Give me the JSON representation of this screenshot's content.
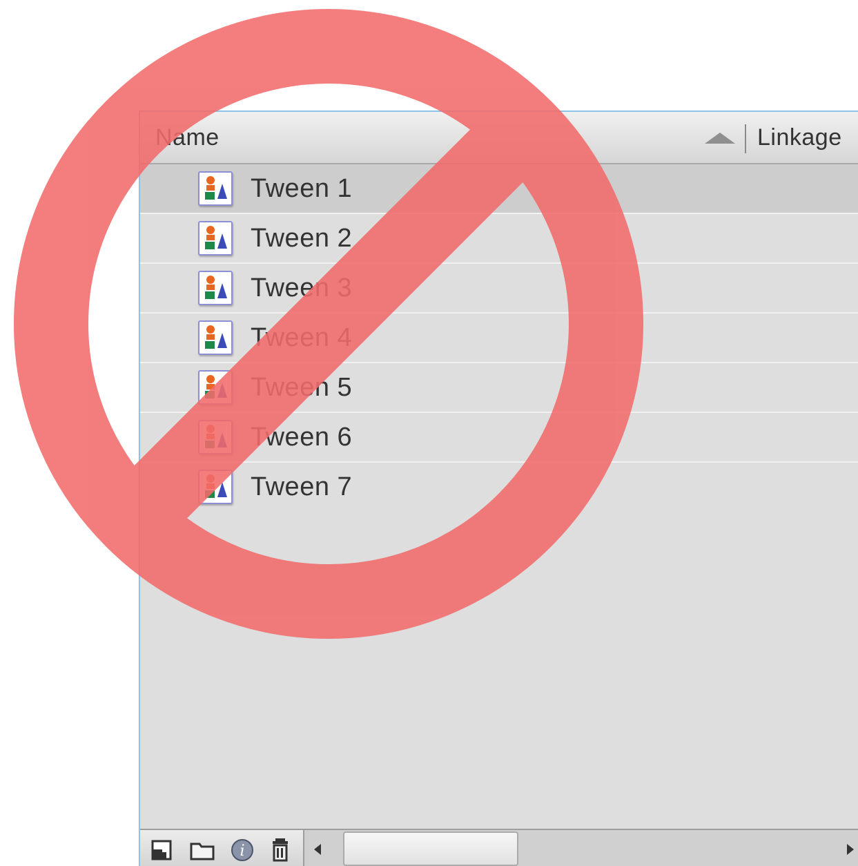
{
  "columns": {
    "name": "Name",
    "linkage": "Linkage"
  },
  "rows": [
    {
      "label": "Tween 1",
      "icon": "graphic-symbol-icon",
      "selected": true
    },
    {
      "label": "Tween 2",
      "icon": "graphic-symbol-icon",
      "selected": false
    },
    {
      "label": "Tween 3",
      "icon": "graphic-symbol-icon",
      "selected": false
    },
    {
      "label": "Tween 4",
      "icon": "graphic-symbol-icon",
      "selected": false
    },
    {
      "label": "Tween 5",
      "icon": "graphic-symbol-icon",
      "selected": false
    },
    {
      "label": "Tween 6",
      "icon": "graphic-symbol-icon",
      "selected": false
    },
    {
      "label": "Tween 7",
      "icon": "graphic-symbol-icon",
      "selected": false
    }
  ],
  "footer_icons": [
    "new-symbol-icon",
    "new-folder-icon",
    "properties-icon",
    "delete-icon"
  ],
  "overlay_icon": "prohibited-icon",
  "colors": {
    "overlay": "#f26b6b",
    "panel_border": "#8cc3e6",
    "panel_background": "#dedede",
    "selected_row": "#cdcdcd"
  }
}
